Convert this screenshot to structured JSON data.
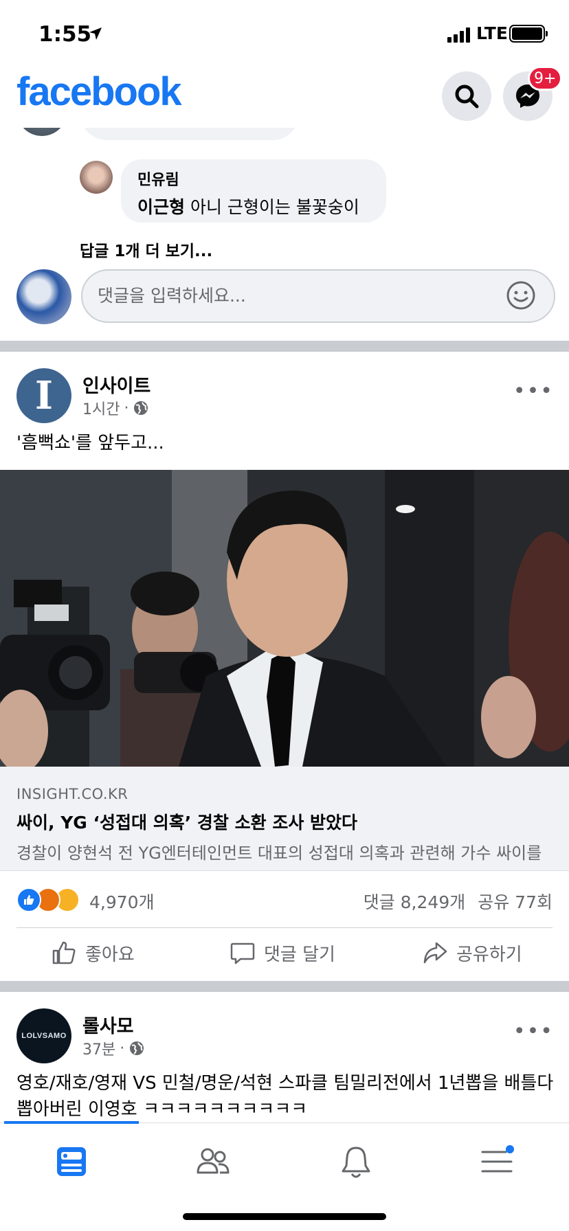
{
  "status_bar": {
    "time": "1:55",
    "network": "LTE"
  },
  "header": {
    "logo": "facebook",
    "messenger_badge": "9+"
  },
  "comments": {
    "reply": {
      "author": "민유림",
      "mention": "이근형",
      "text": " 아니 근형이는 불꽃숭이"
    },
    "more_replies": "답글 1개 더 보기...",
    "compose_placeholder": "댓글을 입력하세요..."
  },
  "post1": {
    "page_name": "인사이트",
    "avatar_letter": "I",
    "time": "1시간",
    "dot": "·",
    "text": "'흠뻑쇼'를 앞두고...",
    "link": {
      "domain": "INSIGHT.CO.KR",
      "title": "싸이, YG ‘성접대 의혹’ 경찰 소환 조사 받았다",
      "description": "경찰이 양현석 전 YG엔터테인먼트 대표의 성접대 의혹과 관련해 가수 싸이를"
    },
    "reaction_count": "4,970개",
    "comment_count": "댓글 8,249개",
    "share_count": "공유 77회",
    "actions": {
      "like": "좋아요",
      "comment": "댓글 달기",
      "share": "공유하기"
    }
  },
  "post2": {
    "page_name": "롤사모",
    "avatar_text": "LOLVSAMO",
    "time": "37분",
    "dot": "·",
    "text": "영호/재호/영재 VS 민철/명운/석현 스파클 팀밀리전에서 1년뽑을 배틀다뽑아버린 이영호 ㅋㅋㅋㅋㅋㅋㅋㅋㅋㅋ"
  },
  "colors": {
    "brand": "#1877f2",
    "badge": "#e41e3f",
    "secondary_text": "#65676b"
  }
}
